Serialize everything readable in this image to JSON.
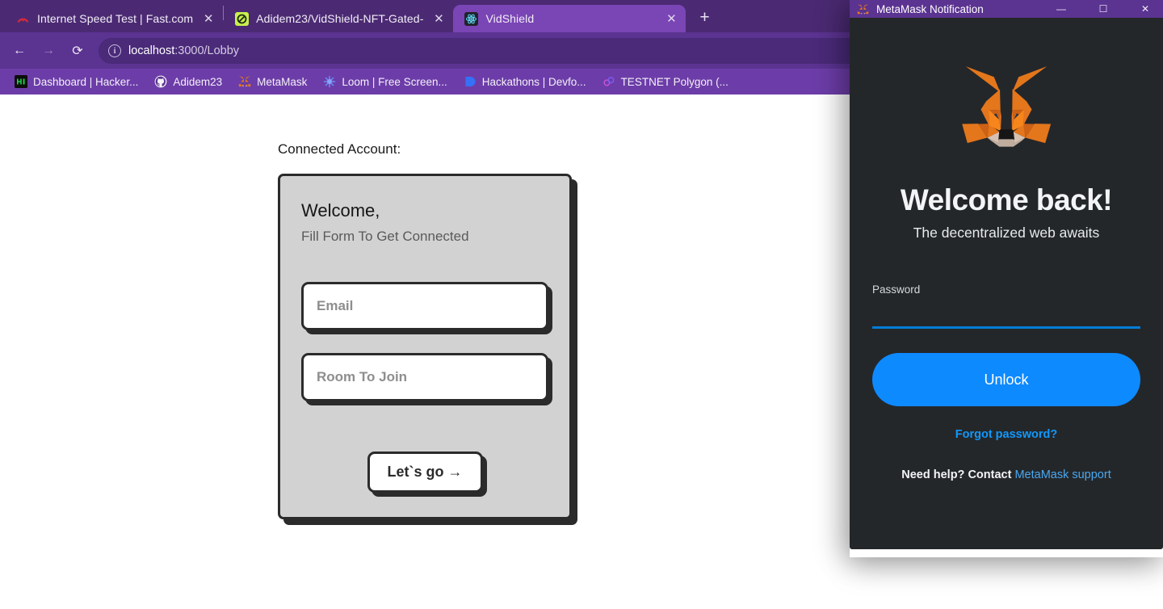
{
  "browser": {
    "tabs": [
      {
        "title": "Internet Speed Test | Fast.com",
        "favicon": "fast-com-icon",
        "active": false,
        "close_label": "✕"
      },
      {
        "title": "Adidem23/VidShield-NFT-Gated-",
        "favicon": "github-repo-icon",
        "active": false,
        "close_label": "✕"
      },
      {
        "title": "VidShield",
        "favicon": "react-icon",
        "active": true,
        "close_label": "✕"
      }
    ],
    "new_tab_label": "+",
    "nav": {
      "back_label": "←",
      "forward_label": "→",
      "reload_label": "⟳"
    },
    "omnibox": {
      "info_label": "i",
      "url_host": "localhost",
      "url_rest": ":3000/Lobby",
      "download_icon": "download-icon"
    },
    "bookmarks": [
      {
        "label": "Dashboard | Hacker...",
        "icon": "hi-icon",
        "icon_text": "HI"
      },
      {
        "label": "Adidem23",
        "icon": "github-icon"
      },
      {
        "label": "MetaMask",
        "icon": "metamask-fox-icon"
      },
      {
        "label": "Loom | Free Screen...",
        "icon": "loom-icon"
      },
      {
        "label": "Hackathons | Devfo...",
        "icon": "devfolio-icon"
      },
      {
        "label": "TESTNET Polygon (...",
        "icon": "polygon-icon"
      }
    ]
  },
  "page": {
    "connected_account_label": "Connected Account:",
    "card": {
      "heading": "Welcome,",
      "subheading": "Fill Form To Get Connected",
      "email_placeholder": "Email",
      "email_value": "",
      "room_placeholder": "Room To Join",
      "room_value": "",
      "submit_label": "Let`s go  →"
    }
  },
  "metamask": {
    "window_title": "MetaMask Notification",
    "titlebar_icon": "metamask-fox-icon",
    "window_controls": {
      "minimize": "—",
      "maximize": "☐",
      "close": "✕"
    },
    "logo_icon": "metamask-fox-logo",
    "heading": "Welcome back!",
    "subheading": "The decentralized web awaits",
    "password_label": "Password",
    "password_value": "",
    "unlock_label": "Unlock",
    "forgot_password_label": "Forgot password?",
    "help_prefix": "Need help? Contact ",
    "help_link_label": "MetaMask support"
  },
  "colors": {
    "browser_tabstrip": "#4b2a73",
    "browser_toolbar": "#5b3391",
    "browser_bookmarks": "#6c3da8",
    "active_tab": "#7a45b5",
    "metamask_bg": "#24272a",
    "metamask_accent": "#0e8aff",
    "metamask_link": "#1098fc",
    "card_bg": "#d2d2d2",
    "card_border": "#2b2b2b"
  }
}
